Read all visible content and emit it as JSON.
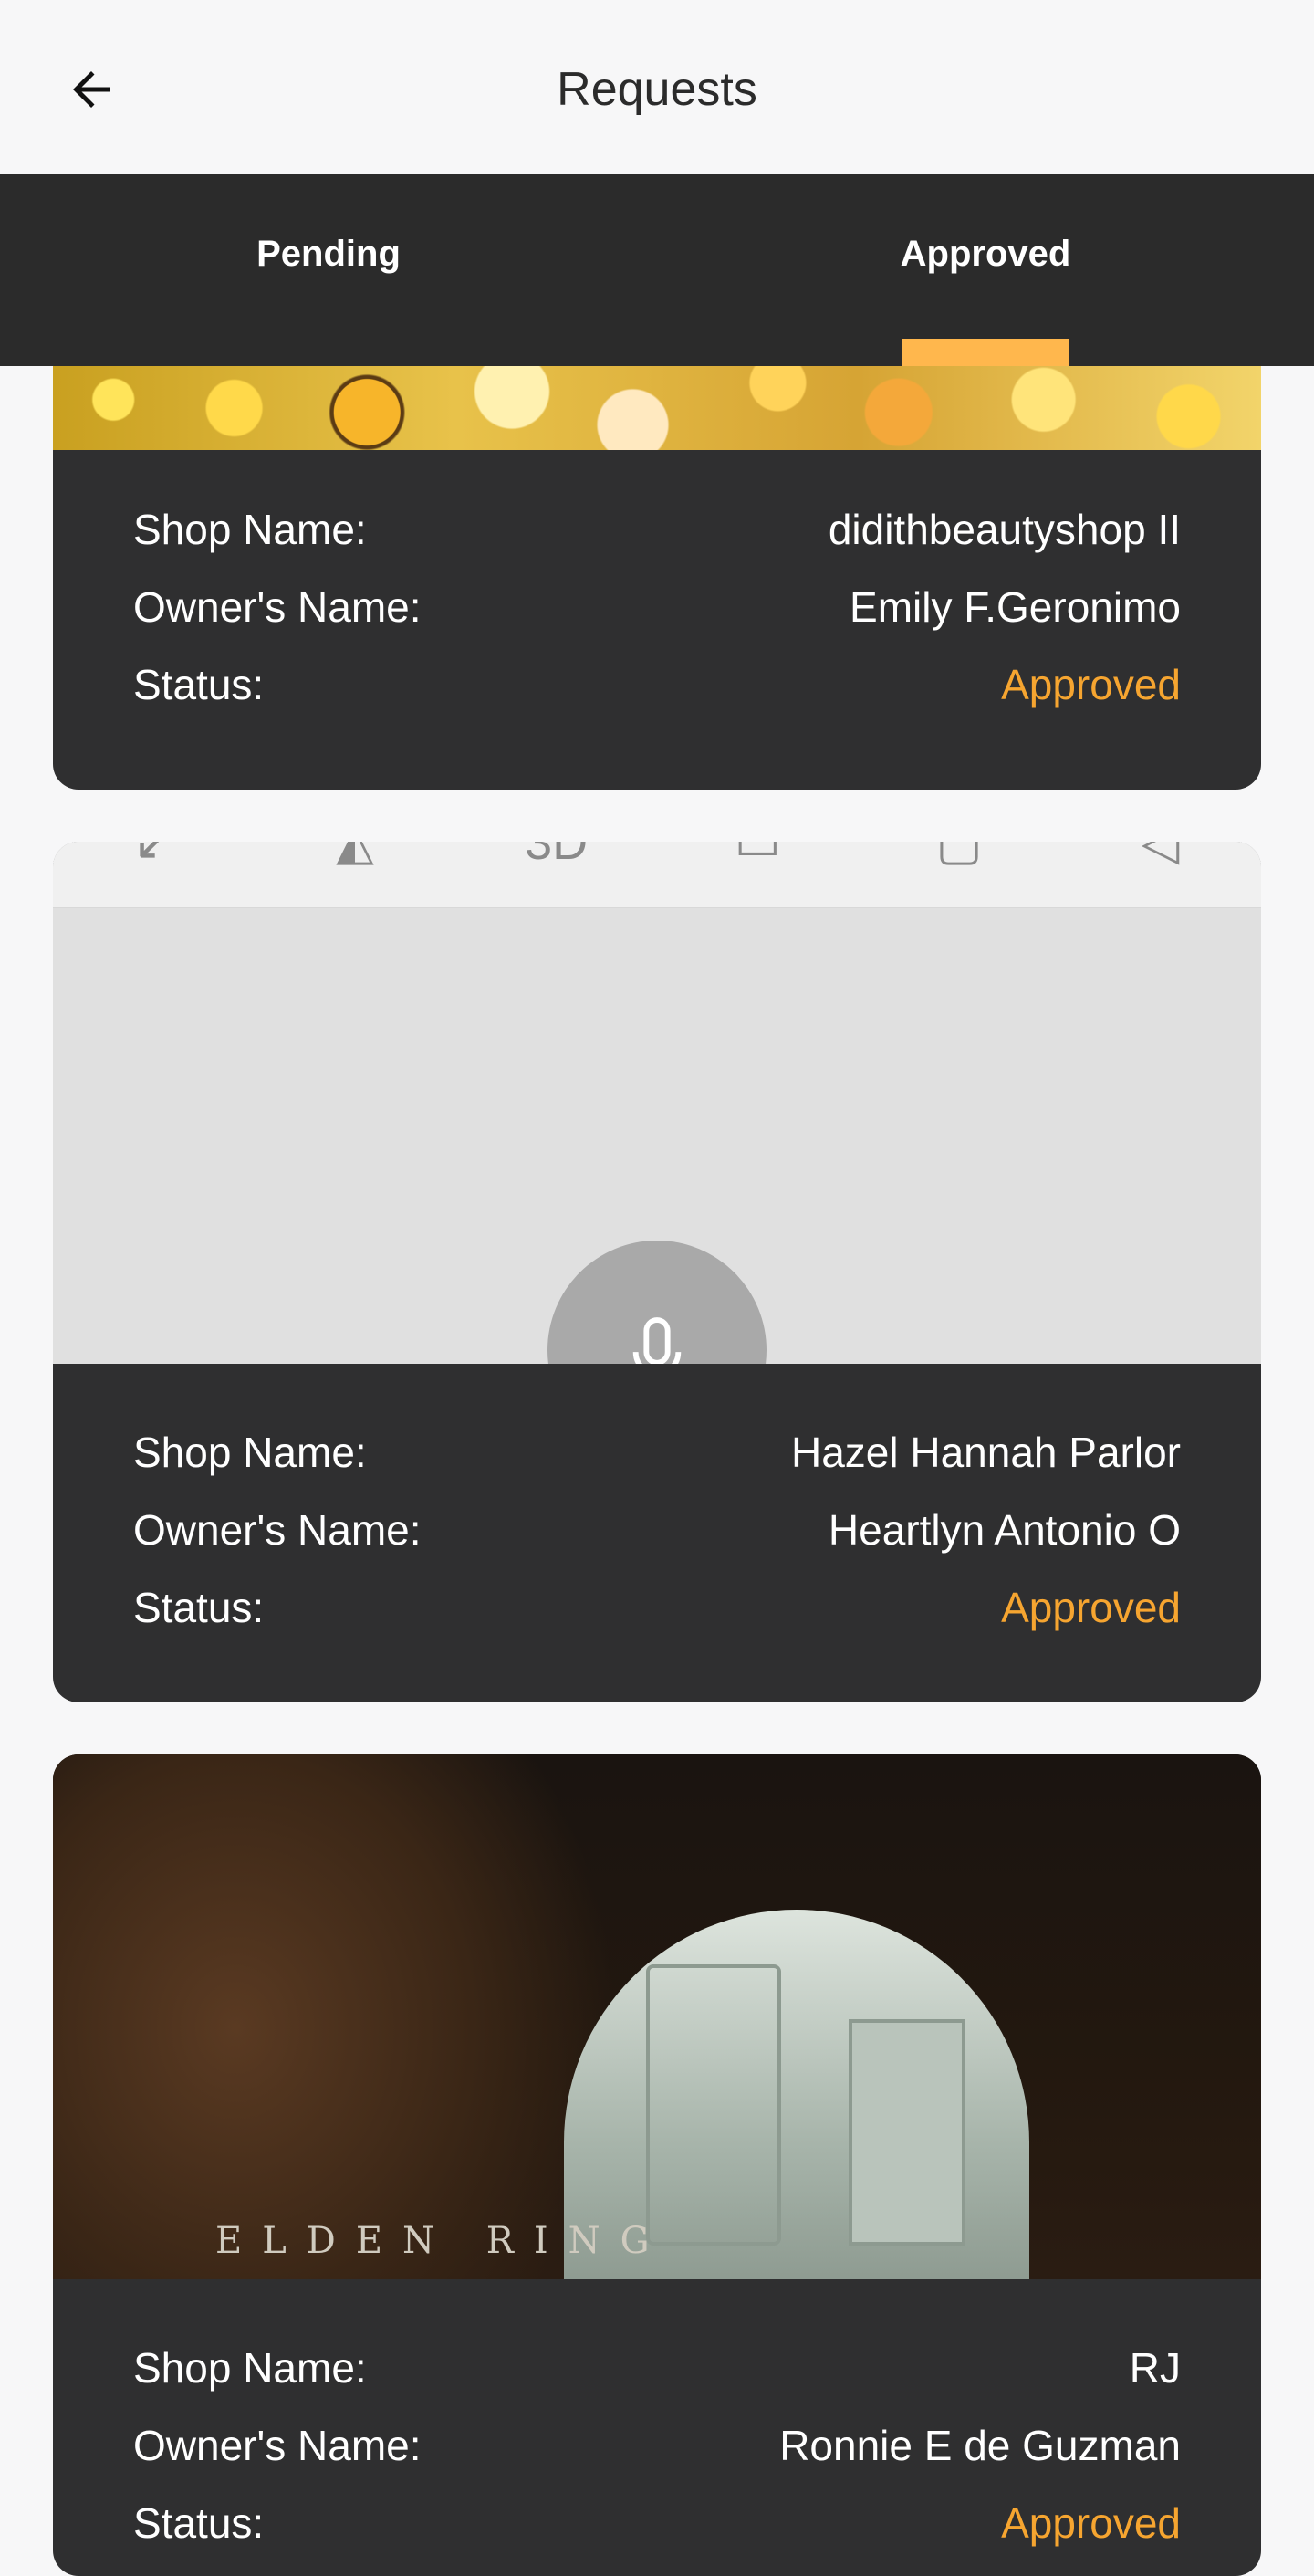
{
  "header": {
    "title": "Requests"
  },
  "tabs": [
    {
      "label": "Pending",
      "active": false
    },
    {
      "label": "Approved",
      "active": true
    }
  ],
  "colors": {
    "accent": "#ffb74d",
    "status_approved": "#f6a530",
    "tabbar": "#2b2b2b",
    "card": "#2f2f30"
  },
  "labels": {
    "shop_name": "Shop Name:",
    "owner_name": "Owner's Name:",
    "status": "Status:"
  },
  "cards": [
    {
      "shop_name": "didithbeautyshop II",
      "owner_name": "Emily F.Geronimo",
      "status": "Approved"
    },
    {
      "shop_name": "Hazel Hannah Parlor",
      "owner_name": "Heartlyn Antonio O",
      "status": "Approved"
    },
    {
      "shop_name": "RJ",
      "owner_name": "Ronnie E de Guzman",
      "status": "Approved",
      "image_text": "ELDEN RING"
    }
  ]
}
